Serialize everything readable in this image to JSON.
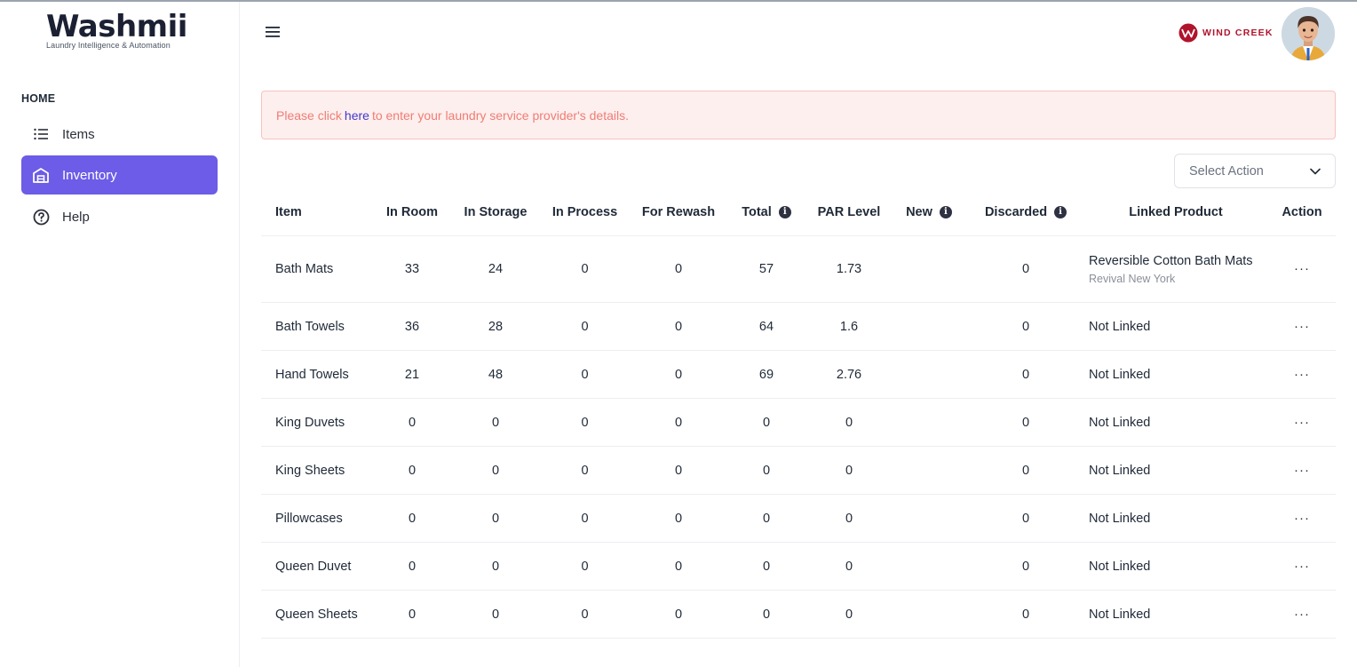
{
  "logo": {
    "word": "Washmii",
    "tagline": "Laundry Intelligence & Automation"
  },
  "sidebar": {
    "section": "HOME",
    "items": [
      {
        "label": "Items",
        "icon": "list-icon"
      },
      {
        "label": "Inventory",
        "icon": "warehouse-icon",
        "active": true
      },
      {
        "label": "Help",
        "icon": "help-circle-icon"
      }
    ]
  },
  "header": {
    "brand": "WIND CREEK"
  },
  "alert": {
    "pre": "Please click",
    "link": "here",
    "post": "to enter your laundry service provider's details."
  },
  "select": {
    "label": "Select Action"
  },
  "table": {
    "headers": {
      "item": "Item",
      "in_room": "In Room",
      "in_storage": "In Storage",
      "in_process": "In Process",
      "for_rewash": "For Rewash",
      "total": "Total",
      "par_level": "PAR Level",
      "new": "New",
      "discarded": "Discarded",
      "linked_product": "Linked Product",
      "action": "Action"
    },
    "rows": [
      {
        "item": "Bath Mats",
        "in_room": "33",
        "in_storage": "24",
        "in_process": "0",
        "for_rewash": "0",
        "total": "57",
        "par_level": "1.73",
        "new": "",
        "discarded": "0",
        "linked": "Reversible Cotton Bath Mats",
        "linked_sub": "Revival New York"
      },
      {
        "item": "Bath Towels",
        "in_room": "36",
        "in_storage": "28",
        "in_process": "0",
        "for_rewash": "0",
        "total": "64",
        "par_level": "1.6",
        "new": "",
        "discarded": "0",
        "linked": "Not Linked",
        "linked_sub": ""
      },
      {
        "item": "Hand Towels",
        "in_room": "21",
        "in_storage": "48",
        "in_process": "0",
        "for_rewash": "0",
        "total": "69",
        "par_level": "2.76",
        "new": "",
        "discarded": "0",
        "linked": "Not Linked",
        "linked_sub": ""
      },
      {
        "item": "King Duvets",
        "in_room": "0",
        "in_storage": "0",
        "in_process": "0",
        "for_rewash": "0",
        "total": "0",
        "par_level": "0",
        "new": "",
        "discarded": "0",
        "linked": "Not Linked",
        "linked_sub": ""
      },
      {
        "item": "King Sheets",
        "in_room": "0",
        "in_storage": "0",
        "in_process": "0",
        "for_rewash": "0",
        "total": "0",
        "par_level": "0",
        "new": "",
        "discarded": "0",
        "linked": "Not Linked",
        "linked_sub": ""
      },
      {
        "item": "Pillowcases",
        "in_room": "0",
        "in_storage": "0",
        "in_process": "0",
        "for_rewash": "0",
        "total": "0",
        "par_level": "0",
        "new": "",
        "discarded": "0",
        "linked": "Not Linked",
        "linked_sub": ""
      },
      {
        "item": "Queen Duvet",
        "in_room": "0",
        "in_storage": "0",
        "in_process": "0",
        "for_rewash": "0",
        "total": "0",
        "par_level": "0",
        "new": "",
        "discarded": "0",
        "linked": "Not Linked",
        "linked_sub": ""
      },
      {
        "item": "Queen Sheets",
        "in_room": "0",
        "in_storage": "0",
        "in_process": "0",
        "for_rewash": "0",
        "total": "0",
        "par_level": "0",
        "new": "",
        "discarded": "0",
        "linked": "Not Linked",
        "linked_sub": ""
      }
    ]
  },
  "colors": {
    "accent": "#6c5ce7",
    "alert_text": "#ef7d74",
    "alert_bg": "#fdefee",
    "link": "#4338ca",
    "brand": "#b0142c"
  }
}
